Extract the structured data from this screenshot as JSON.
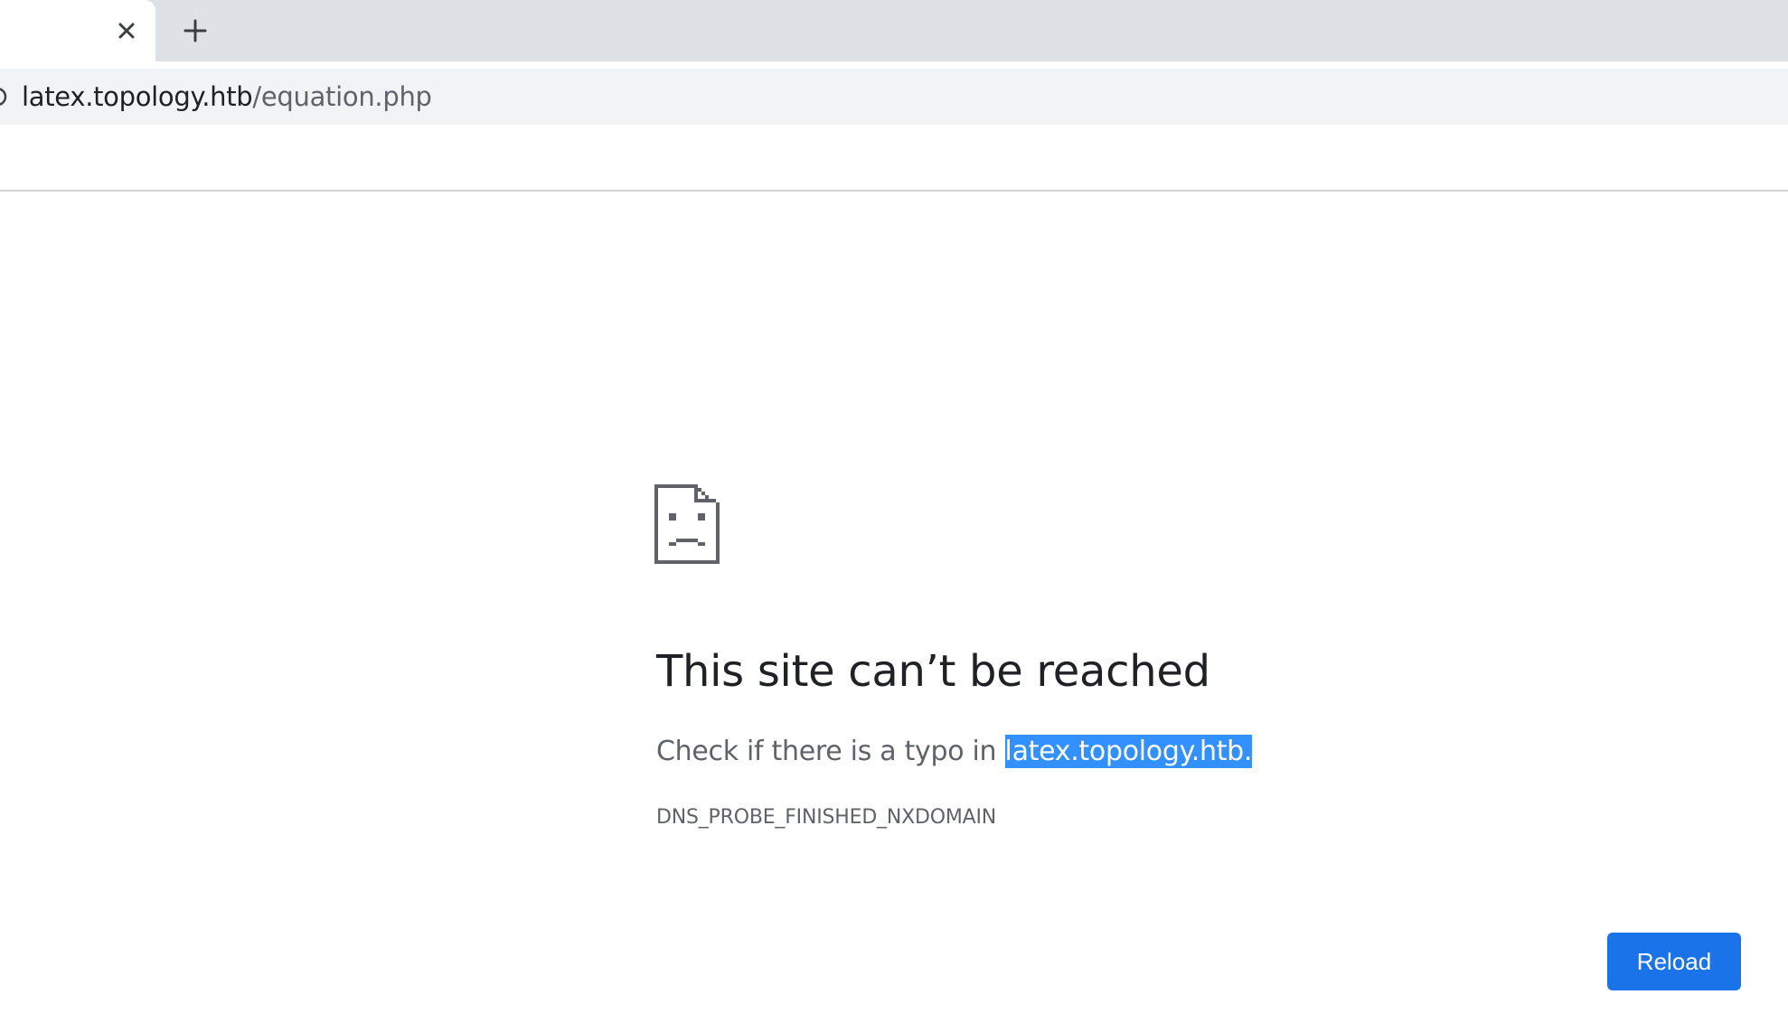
{
  "browser": {
    "tab": {
      "close_icon": "close-icon",
      "new_tab_icon": "plus-icon"
    },
    "omnibox": {
      "site_info_icon": "info-icon",
      "url_host": "latex.topology.htb",
      "url_path": "/equation.php"
    }
  },
  "error_page": {
    "icon": "sad-page-icon",
    "title": "This site can’t be reached",
    "message_prefix": "Check if there is a typo in",
    "message_host": "latex.topology.htb.",
    "error_code": "DNS_PROBE_FINISHED_NXDOMAIN",
    "reload_label": "Reload"
  },
  "colors": {
    "accent": "#1a73e8",
    "selection": "#3390ff",
    "tabstrip": "#dee1e6",
    "omnibox": "#f1f3f4"
  }
}
